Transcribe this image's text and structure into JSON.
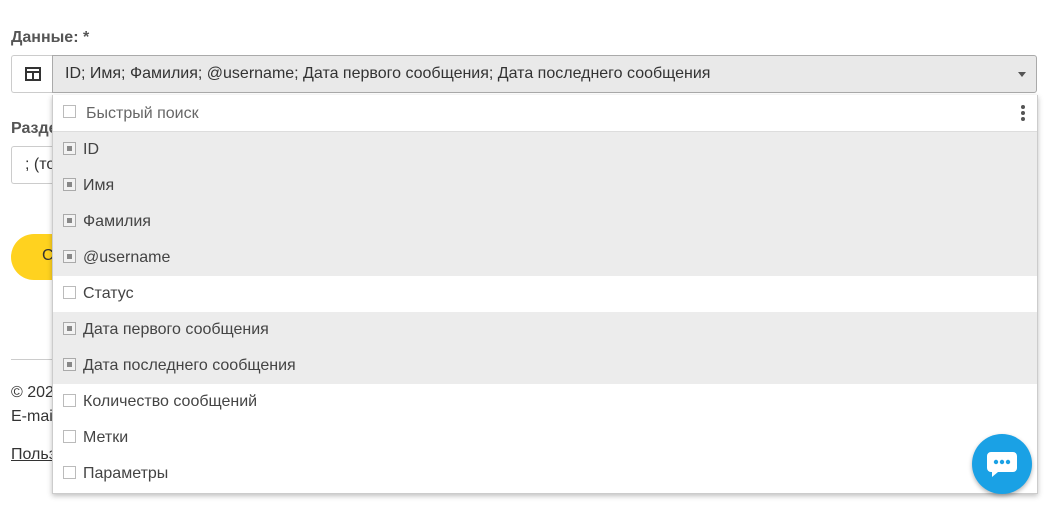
{
  "form": {
    "data_label": "Данные: *",
    "data_value": "ID; Имя; Фамилия; @username; Дата первого сообщения; Дата последнего сообщения"
  },
  "background": {
    "label2": "Разде",
    "input2_value": "; (то",
    "button_text": "С",
    "copyright": "© 202",
    "email": "E-mai",
    "link": "Польз"
  },
  "dropdown": {
    "search_placeholder": "Быстрый поиск",
    "options": [
      {
        "label": "ID",
        "selected": true
      },
      {
        "label": "Имя",
        "selected": true
      },
      {
        "label": "Фамилия",
        "selected": true
      },
      {
        "label": "@username",
        "selected": true
      },
      {
        "label": "Статус",
        "selected": false
      },
      {
        "label": "Дата первого сообщения",
        "selected": true
      },
      {
        "label": "Дата последнего сообщения",
        "selected": true
      },
      {
        "label": "Количество сообщений",
        "selected": false
      },
      {
        "label": "Метки",
        "selected": false
      },
      {
        "label": "Параметры",
        "selected": false
      }
    ]
  },
  "colors": {
    "accent_button": "#ffd21f",
    "chat_bubble": "#1aa1e5",
    "selected_row": "#ececec"
  },
  "icons": {
    "addon": "columns-icon",
    "caret": "chevron-down-icon",
    "menu": "more-vertical-icon",
    "chat": "chat-icon"
  }
}
